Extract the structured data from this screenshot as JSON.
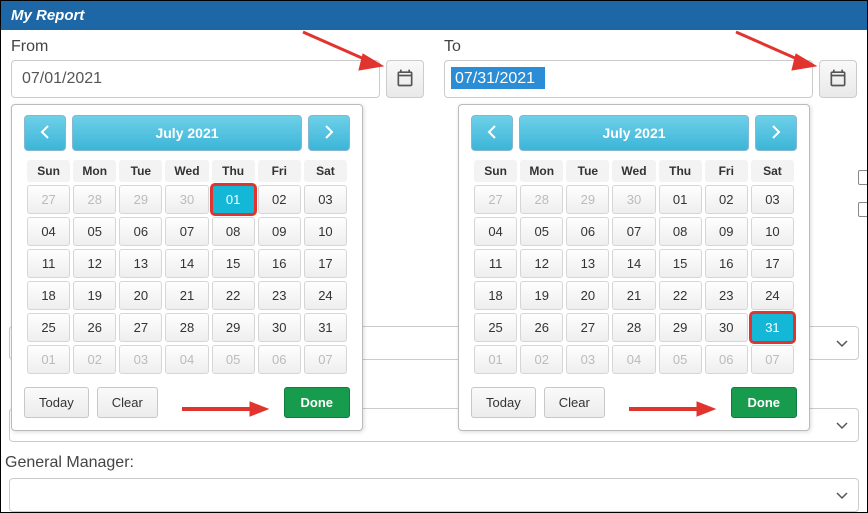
{
  "window": {
    "title": "My Report"
  },
  "from": {
    "label": "From",
    "value": "07/01/2021",
    "picker": {
      "month_label": "July 2021",
      "dow": [
        "Sun",
        "Mon",
        "Tue",
        "Wed",
        "Thu",
        "Fri",
        "Sat"
      ],
      "weeks": [
        [
          {
            "d": "27",
            "o": true
          },
          {
            "d": "28",
            "o": true
          },
          {
            "d": "29",
            "o": true
          },
          {
            "d": "30",
            "o": true
          },
          {
            "d": "01",
            "sel": true,
            "hl": true
          },
          {
            "d": "02"
          },
          {
            "d": "03"
          }
        ],
        [
          {
            "d": "04"
          },
          {
            "d": "05"
          },
          {
            "d": "06"
          },
          {
            "d": "07"
          },
          {
            "d": "08"
          },
          {
            "d": "09"
          },
          {
            "d": "10"
          }
        ],
        [
          {
            "d": "11"
          },
          {
            "d": "12"
          },
          {
            "d": "13"
          },
          {
            "d": "14"
          },
          {
            "d": "15"
          },
          {
            "d": "16"
          },
          {
            "d": "17"
          }
        ],
        [
          {
            "d": "18"
          },
          {
            "d": "19"
          },
          {
            "d": "20"
          },
          {
            "d": "21"
          },
          {
            "d": "22"
          },
          {
            "d": "23"
          },
          {
            "d": "24"
          }
        ],
        [
          {
            "d": "25"
          },
          {
            "d": "26"
          },
          {
            "d": "27"
          },
          {
            "d": "28"
          },
          {
            "d": "29"
          },
          {
            "d": "30"
          },
          {
            "d": "31"
          }
        ],
        [
          {
            "d": "01",
            "o": true
          },
          {
            "d": "02",
            "o": true
          },
          {
            "d": "03",
            "o": true
          },
          {
            "d": "04",
            "o": true
          },
          {
            "d": "05",
            "o": true
          },
          {
            "d": "06",
            "o": true
          },
          {
            "d": "07",
            "o": true
          }
        ]
      ],
      "today_label": "Today",
      "clear_label": "Clear",
      "done_label": "Done"
    }
  },
  "to": {
    "label": "To",
    "value": "07/31/2021",
    "picker": {
      "month_label": "July 2021",
      "dow": [
        "Sun",
        "Mon",
        "Tue",
        "Wed",
        "Thu",
        "Fri",
        "Sat"
      ],
      "weeks": [
        [
          {
            "d": "27",
            "o": true
          },
          {
            "d": "28",
            "o": true
          },
          {
            "d": "29",
            "o": true
          },
          {
            "d": "30",
            "o": true
          },
          {
            "d": "01"
          },
          {
            "d": "02"
          },
          {
            "d": "03"
          }
        ],
        [
          {
            "d": "04"
          },
          {
            "d": "05"
          },
          {
            "d": "06"
          },
          {
            "d": "07"
          },
          {
            "d": "08"
          },
          {
            "d": "09"
          },
          {
            "d": "10"
          }
        ],
        [
          {
            "d": "11"
          },
          {
            "d": "12"
          },
          {
            "d": "13"
          },
          {
            "d": "14"
          },
          {
            "d": "15"
          },
          {
            "d": "16"
          },
          {
            "d": "17"
          }
        ],
        [
          {
            "d": "18"
          },
          {
            "d": "19"
          },
          {
            "d": "20"
          },
          {
            "d": "21"
          },
          {
            "d": "22"
          },
          {
            "d": "23"
          },
          {
            "d": "24"
          }
        ],
        [
          {
            "d": "25"
          },
          {
            "d": "26"
          },
          {
            "d": "27"
          },
          {
            "d": "28"
          },
          {
            "d": "29"
          },
          {
            "d": "30"
          },
          {
            "d": "31",
            "sel": true,
            "hl": true
          }
        ],
        [
          {
            "d": "01",
            "o": true
          },
          {
            "d": "02",
            "o": true
          },
          {
            "d": "03",
            "o": true
          },
          {
            "d": "04",
            "o": true
          },
          {
            "d": "05",
            "o": true
          },
          {
            "d": "06",
            "o": true
          },
          {
            "d": "07",
            "o": true
          }
        ]
      ],
      "today_label": "Today",
      "clear_label": "Clear",
      "done_label": "Done"
    }
  },
  "general_manager_label": "General Manager:",
  "colors": {
    "accent": "#15b7d6",
    "highlight": "#e2342f",
    "done": "#179b4d",
    "header": "#1d67a6"
  }
}
